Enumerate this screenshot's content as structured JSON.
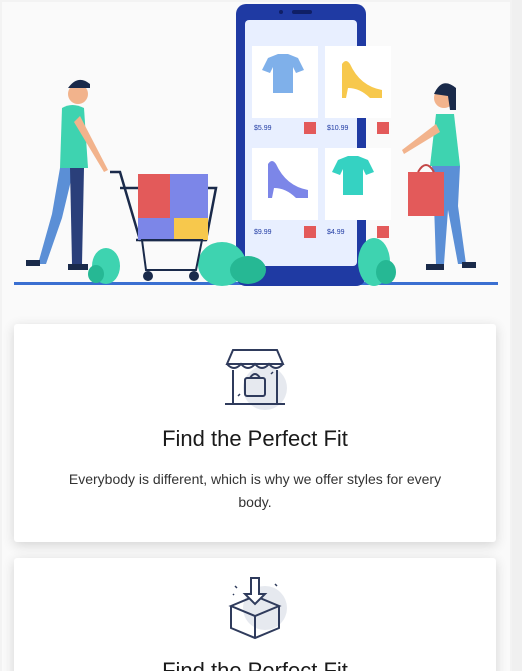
{
  "hero": {
    "products": [
      {
        "name": "t-shirt-blue",
        "price": "$5.99",
        "color": "#7fb0ea"
      },
      {
        "name": "heel-yellow",
        "price": "$10.99",
        "color": "#f7c84c"
      },
      {
        "name": "heel-blue",
        "price": "$9.99",
        "color": "#7c86e8"
      },
      {
        "name": "t-shirt-teal",
        "price": "$4.99",
        "color": "#35d2c2"
      }
    ]
  },
  "cards": [
    {
      "icon": "shop-bag-icon",
      "title": "Find the Perfect Fit",
      "description": "Everybody is different, which is why we offer styles for every body."
    },
    {
      "icon": "box-download-icon",
      "title": "Find the Perfect Fit"
    }
  ],
  "colors": {
    "phone": "#1f3aa3",
    "accent_red": "#e35a5a",
    "teal": "#3ed3b0",
    "ground_line": "#3a6fd1"
  }
}
